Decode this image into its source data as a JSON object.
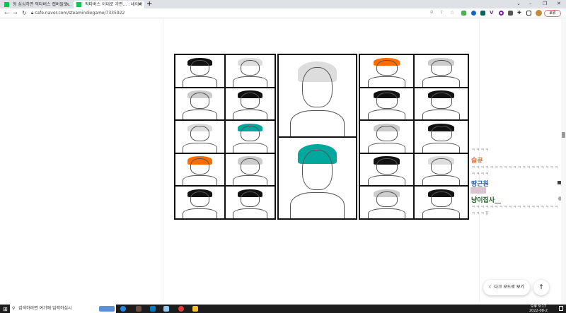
{
  "browser": {
    "tabs": [
      {
        "title": "형 심심하면 픽타버스 캡버들로..."
      },
      {
        "title": "픽타버스 이대로 가면... : 네이버"
      }
    ],
    "new_tab": "+",
    "url": "cafe.naver.com/steamindiegame/7335922",
    "profile_label": "로류",
    "window_controls": [
      "⌄",
      "–",
      "❐",
      "✕"
    ]
  },
  "chat": {
    "top_fade": "ㅋㅋㅋㅋ",
    "messages": [
      {
        "name": "슬큐",
        "color": "#d9763f",
        "text": "ㅋㅋㅋㅋㅋㅋㅋㅋㅋㅋㅋㅋㅋㅋㅋㅋㅋㅋㅋㅋㅋㅋㅋ"
      },
      {
        "name": "땅근원",
        "color": "#1a5fb4",
        "text": ""
      },
      {
        "name": "냥이집사__",
        "color": "#1b5e20",
        "text": "ㅋㅋㅋㅋㅋㅋㅋㅋㅋㅋㅋㅋㅋㅋㅋㅋㅋㅋㅋㅋㅋㅋ뀨"
      }
    ]
  },
  "buttons": {
    "dark_mode": "다크 모드로 보기",
    "scroll_top": "↑"
  },
  "taskbar": {
    "search_placeholder": "검색하려면 여기에 입력하십시",
    "time": "오후 9:17",
    "date": "2022-08-2"
  },
  "colors": {
    "accent_green": "#03c75a"
  }
}
